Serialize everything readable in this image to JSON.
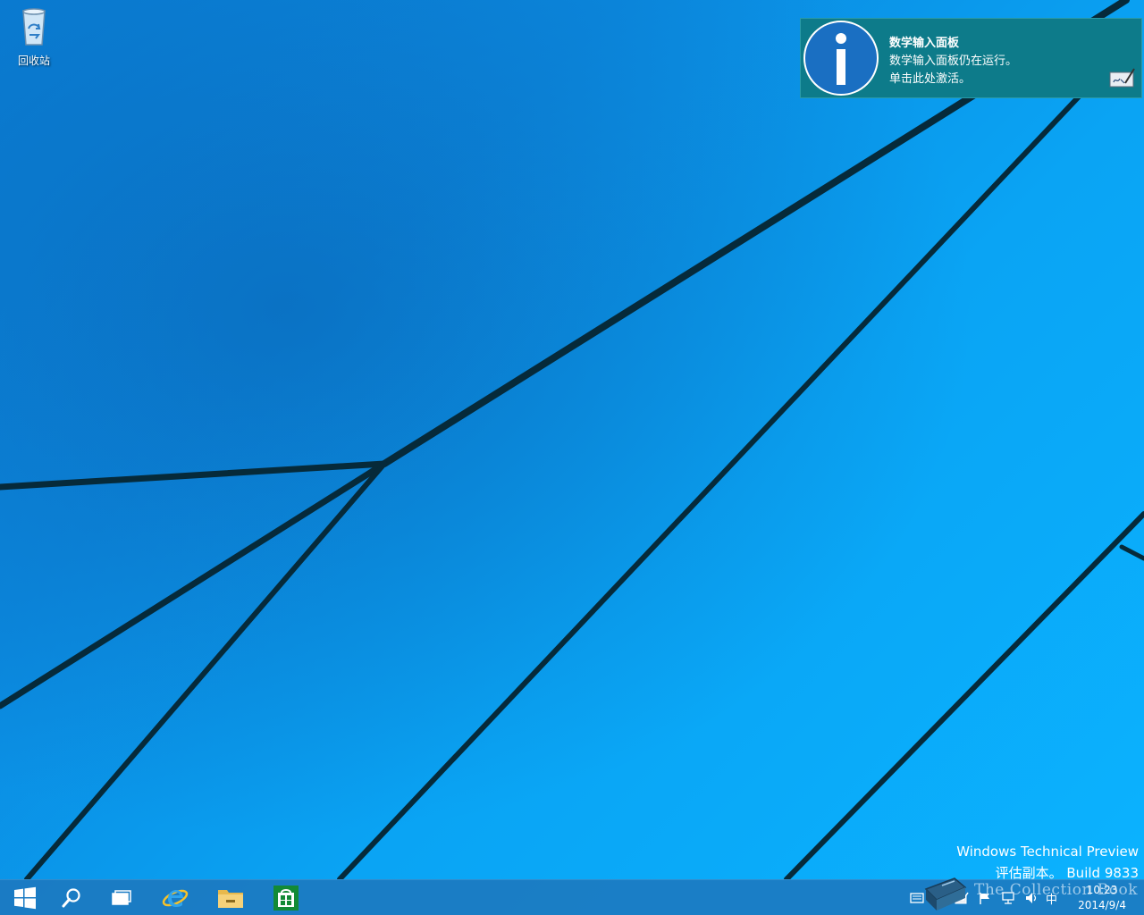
{
  "desktop": {
    "icons": [
      {
        "label": "回收站",
        "icon": "recycle-bin-icon"
      }
    ]
  },
  "toast": {
    "title": "数学输入面板",
    "line1": "数学输入面板仍在运行。",
    "line2": "单击此处激活。",
    "icon": "info-icon",
    "app_icon": "math-input-panel-icon",
    "background": "#0d7b8a"
  },
  "watermark": {
    "line1": "Windows Technical Preview",
    "line2": "评估副本。 Build 9833"
  },
  "taskbar": {
    "buttons": [
      {
        "name": "start",
        "icon": "windows-logo-icon"
      },
      {
        "name": "search",
        "icon": "search-icon"
      },
      {
        "name": "task-view",
        "icon": "task-view-icon"
      },
      {
        "name": "internet-explorer",
        "icon": "internet-explorer-icon"
      },
      {
        "name": "file-explorer",
        "icon": "folder-icon"
      },
      {
        "name": "store",
        "icon": "store-icon"
      }
    ],
    "tray": {
      "ime": "中",
      "overlay_text": "The Collection Book",
      "time": "10:23",
      "date": "2014/9/4"
    }
  }
}
